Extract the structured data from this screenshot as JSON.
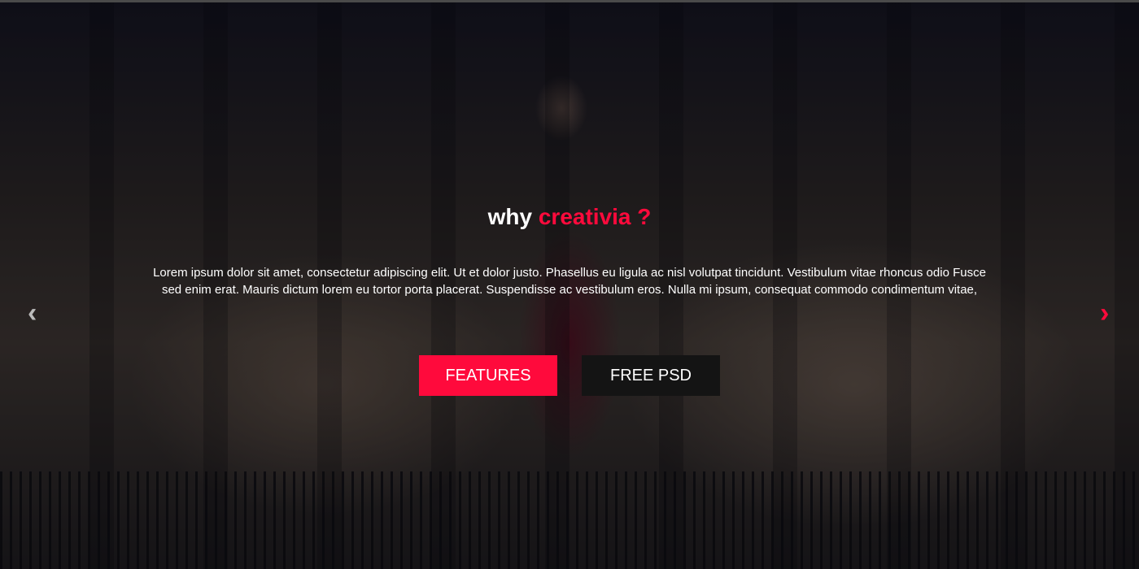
{
  "hero": {
    "title_prefix": "why",
    "title_accent": "creativia ?",
    "description": "Lorem ipsum dolor sit amet, consectetur adipiscing elit. Ut et dolor justo. Phasellus eu ligula ac nisl volutpat tincidunt. Vestibulum vitae rhoncus odio Fusce sed enim erat. Mauris dictum lorem eu tortor porta placerat. Suspendisse ac vestibulum eros. Nulla mi ipsum, consequat commodo condimentum vitae,",
    "buttons": [
      {
        "label": "FEATURES"
      },
      {
        "label": "FREE PSD"
      }
    ],
    "prev_icon": "chevron-left-icon",
    "next_icon": "chevron-right-icon",
    "accent_color": "#ff0a3c"
  }
}
